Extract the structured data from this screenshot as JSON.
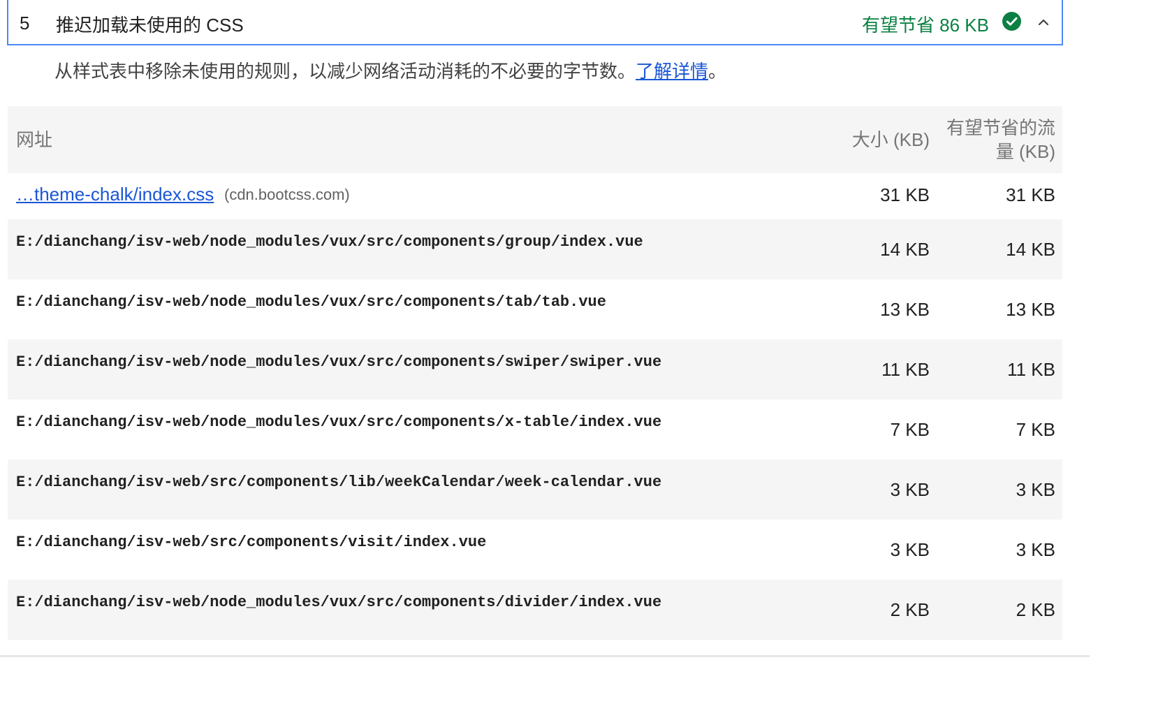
{
  "audit": {
    "index": "5",
    "title": "推迟加载未使用的 CSS",
    "savings": "有望节省 86 KB",
    "status_icon": "pass-check-icon",
    "toggle_icon": "chevron-up-icon",
    "description_text": "从样式表中移除未使用的规则，以减少网络活动消耗的不必要的字节数。",
    "learn_more": "了解详情",
    "description_end": "。",
    "colors": {
      "accent_border": "#4a8af4",
      "pass_green": "#0b8043",
      "link_blue": "#1a56d6"
    }
  },
  "table": {
    "headers": {
      "url": "网址",
      "size": "大小 (KB)",
      "waste_line1": "有望节省的流",
      "waste_line2": "量 (KB)"
    },
    "first_row": {
      "link": "…theme-chalk/index.css",
      "host": "(cdn.bootcss.com)",
      "size": "31 KB",
      "waste": "31 KB"
    },
    "rows": [
      {
        "path": "E:/dianchang/isv-web/node_modules/vux/src/components/group/index.vue",
        "size": "14 KB",
        "waste": "14 KB"
      },
      {
        "path": "E:/dianchang/isv-web/node_modules/vux/src/components/tab/tab.vue",
        "size": "13 KB",
        "waste": "13 KB"
      },
      {
        "path": "E:/dianchang/isv-web/node_modules/vux/src/components/swiper/swiper.vue",
        "size": "11 KB",
        "waste": "11 KB"
      },
      {
        "path": "E:/dianchang/isv-web/node_modules/vux/src/components/x-table/index.vue",
        "size": "7 KB",
        "waste": "7 KB"
      },
      {
        "path": "E:/dianchang/isv-web/src/components/lib/weekCalendar/week-calendar.vue",
        "size": "3 KB",
        "waste": "3 KB"
      },
      {
        "path": "E:/dianchang/isv-web/src/components/visit/index.vue",
        "size": "3 KB",
        "waste": "3 KB"
      },
      {
        "path": "E:/dianchang/isv-web/node_modules/vux/src/components/divider/index.vue",
        "size": "2 KB",
        "waste": "2 KB"
      }
    ]
  }
}
